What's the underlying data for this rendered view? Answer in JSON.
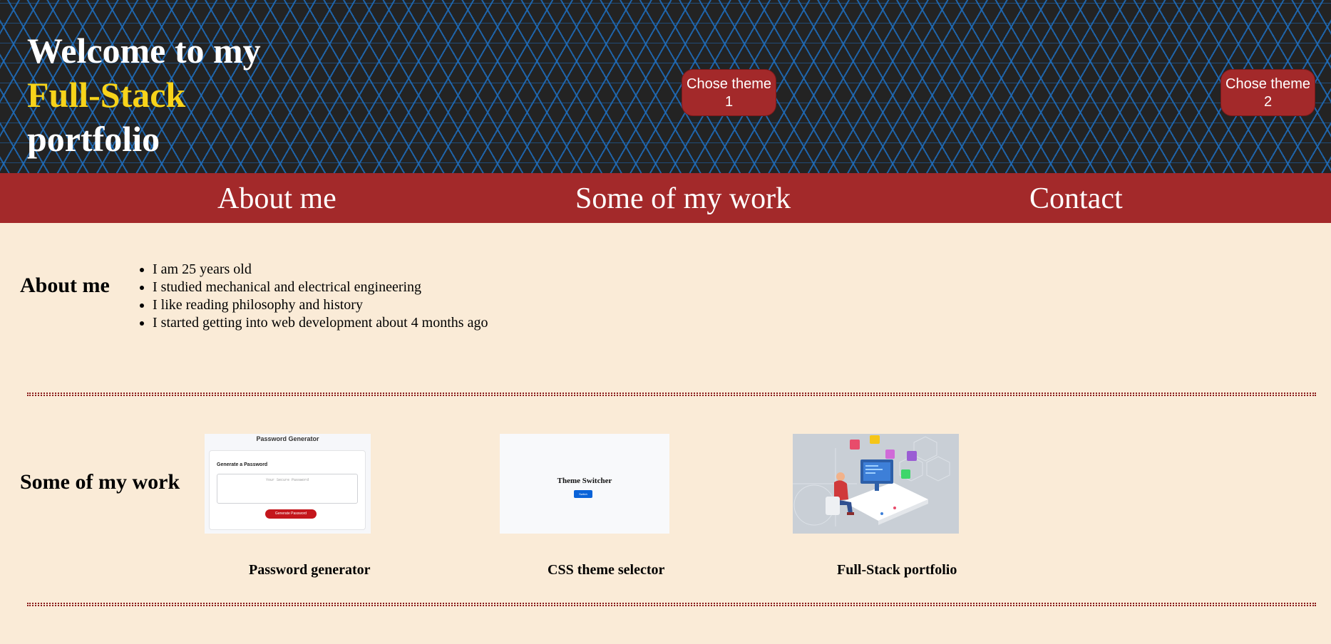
{
  "header": {
    "title_line1": "Welcome to my",
    "title_line2": "Full-Stack",
    "title_line3": "portfolio",
    "theme1_label": "Chose theme 1",
    "theme2_label": "Chose theme 2"
  },
  "nav": {
    "items": [
      {
        "label": "About me"
      },
      {
        "label": "Some of my work"
      },
      {
        "label": "Contact"
      }
    ]
  },
  "about": {
    "heading": "About me",
    "items": [
      "I am 25 years old",
      "I studied mechanical and electrical engineering",
      "I like reading philosophy and history",
      "I started getting into web development about 4 months ago"
    ]
  },
  "work": {
    "heading": "Some of my work",
    "projects": [
      {
        "caption": "Password generator",
        "thumb_title": "Password Generator",
        "thumb_label": "Generate a Password",
        "thumb_placeholder": "Your Secure Password",
        "thumb_button": "Generate Password"
      },
      {
        "caption": "CSS theme selector",
        "thumb_title": "Theme Switcher",
        "thumb_button": "Switch"
      },
      {
        "caption": "Full-Stack portfolio"
      }
    ]
  },
  "colors": {
    "header_bg": "#232323",
    "pattern_blue": "#1e6ebe",
    "accent_red": "#a3292a",
    "accent_yellow": "#f7d31a",
    "page_bg": "#faebd7"
  }
}
